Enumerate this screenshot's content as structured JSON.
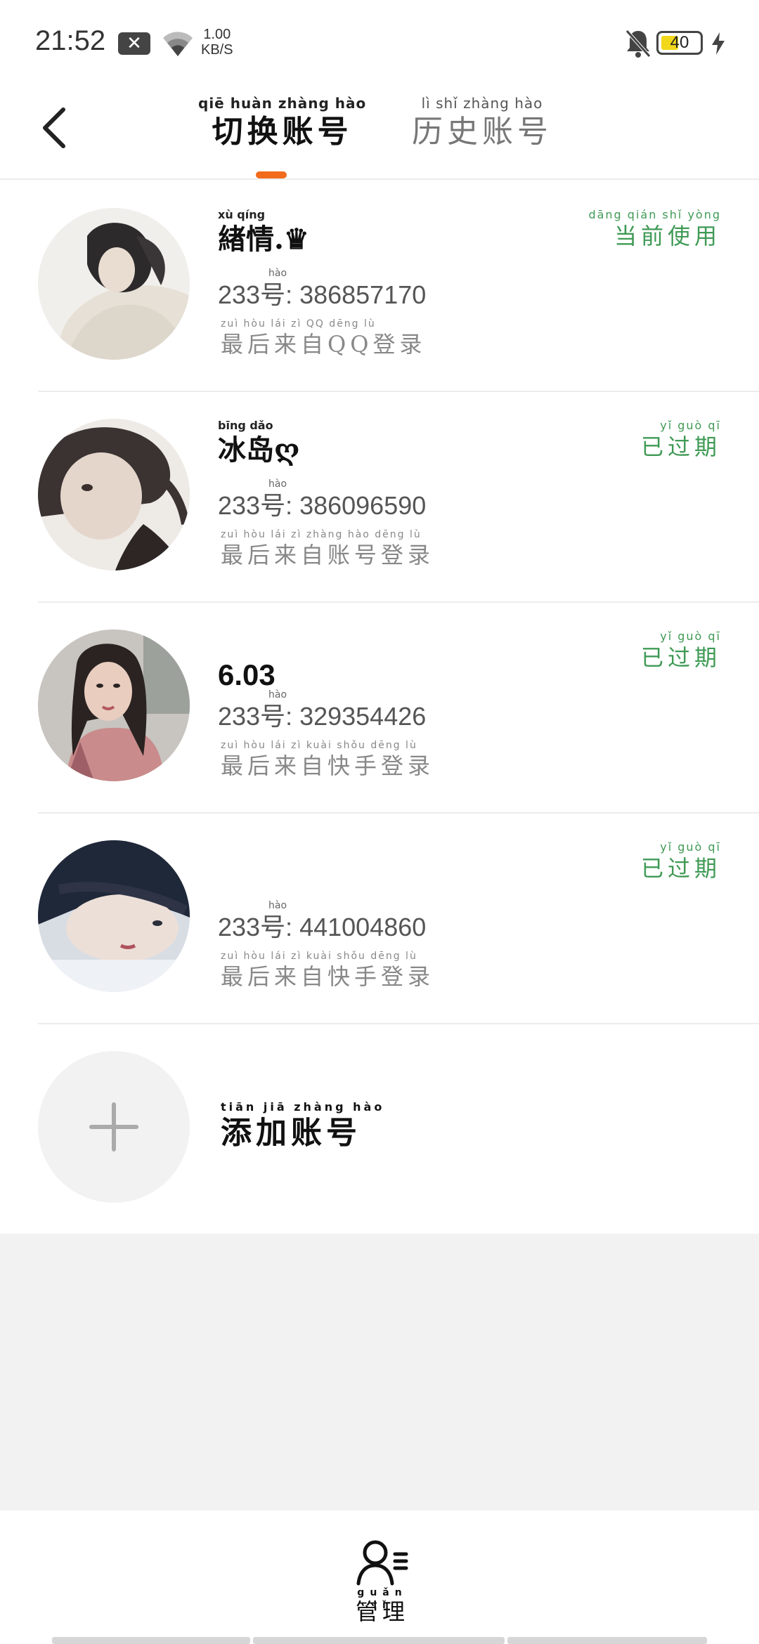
{
  "status_bar": {
    "time": "21:52",
    "net_speed_value": "1.00",
    "net_speed_unit": "KB/S",
    "battery_level": "40",
    "battery_fraction": 0.4
  },
  "header": {
    "tabs": [
      {
        "pinyin": "qiē huàn zhàng hào",
        "label": "切换账号",
        "active": true
      },
      {
        "pinyin": "lì shǐ zhàng hào",
        "label": "历史账号",
        "active": false
      }
    ]
  },
  "accounts": [
    {
      "name_pinyin": "xù qíng",
      "name": "緖情.♛",
      "id_pinyin": "hào",
      "id": "233号: 386857170",
      "source_pinyin": "zuì hòu lái zì QQ dēng lù",
      "source": "最后来自QQ登录",
      "status_pinyin": "dāng qián shǐ yòng",
      "status": "当前使用"
    },
    {
      "name_pinyin": "bīng dǎo",
      "name": "冰岛ღ",
      "id_pinyin": "hào",
      "id": "233号: 386096590",
      "source_pinyin": "zuì hòu lái zì zhàng hào dēng lù",
      "source": "最后来自账号登录",
      "status_pinyin": "yǐ guò qī",
      "status": "已过期"
    },
    {
      "name_pinyin": "",
      "name": "6.03",
      "id_pinyin": "hào",
      "id": "233号: 329354426",
      "source_pinyin": "zuì hòu lái zì kuài shǒu dēng lù",
      "source": "最后来自快手登录",
      "status_pinyin": "yǐ guò qī",
      "status": "已过期"
    },
    {
      "name_pinyin": "",
      "name": "",
      "id_pinyin": "hào",
      "id": "233号: 441004860",
      "source_pinyin": "zuì hòu lái zì kuài shǒu dēng lù",
      "source": "最后来自快手登录",
      "status_pinyin": "yǐ guò qī",
      "status": "已过期"
    }
  ],
  "add_account": {
    "pinyin": "tiān jiā zhàng hào",
    "label": "添加账号"
  },
  "bottom": {
    "manage_pinyin": "guǎn lǐ",
    "manage_label": "管理"
  },
  "colors": {
    "accent": "#f26a1b",
    "status_green": "#3f9a55"
  }
}
